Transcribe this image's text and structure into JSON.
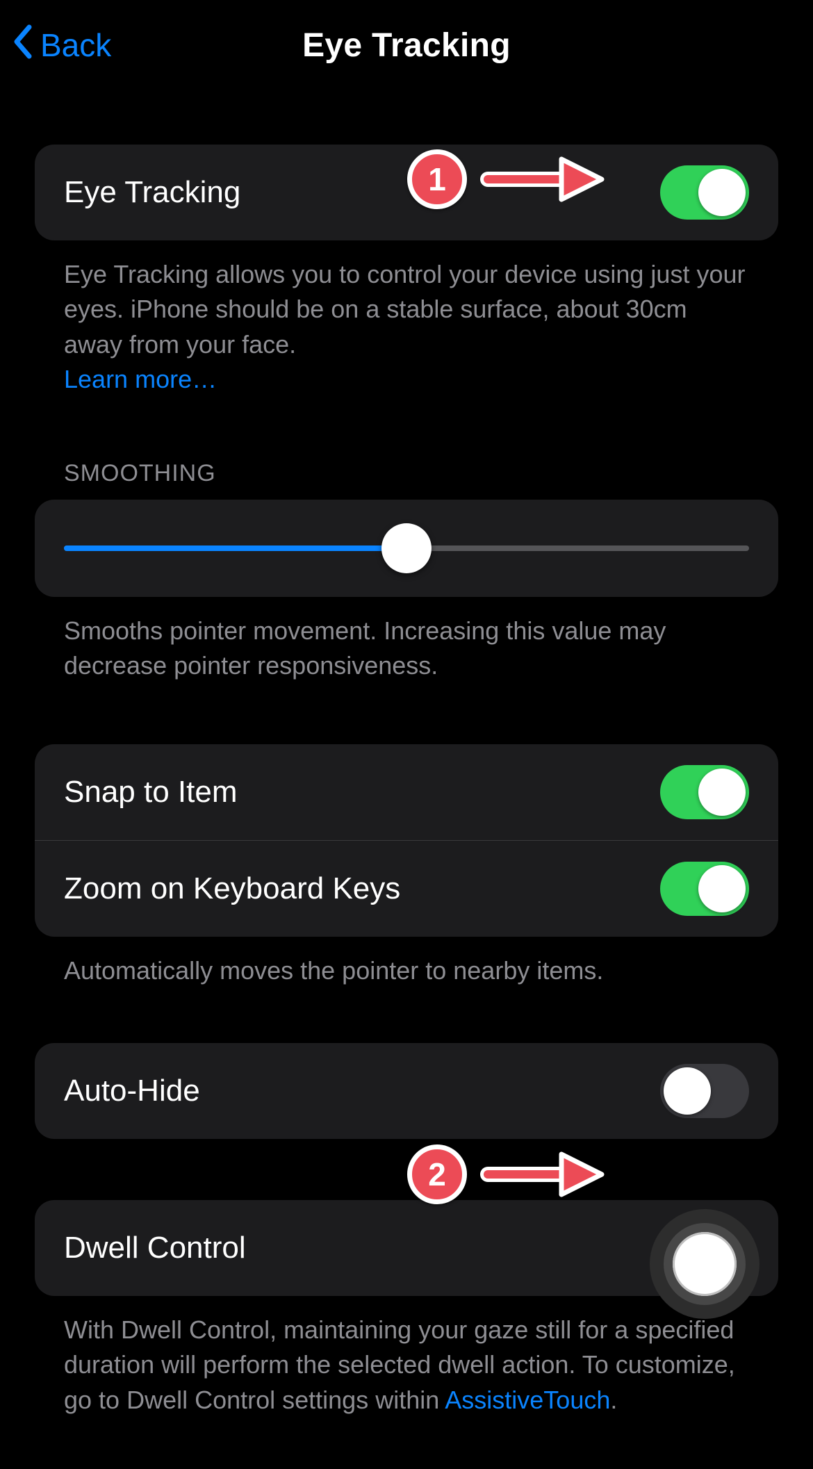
{
  "nav": {
    "back_label": "Back",
    "title": "Eye Tracking"
  },
  "sections": {
    "eye_tracking": {
      "label": "Eye Tracking",
      "on": true,
      "footer": "Eye Tracking allows you to control your device using just your eyes. iPhone should be on a stable surface, about 30cm away from your face.",
      "learn_more": "Learn more…"
    },
    "smoothing": {
      "header": "SMOOTHING",
      "value_percent": 50,
      "footer": "Smooths pointer movement. Increasing this value may decrease pointer responsiveness."
    },
    "snap": {
      "snap_label": "Snap to Item",
      "snap_on": true,
      "zoom_label": "Zoom on Keyboard Keys",
      "zoom_on": true,
      "footer": "Automatically moves the pointer to nearby items."
    },
    "auto_hide": {
      "label": "Auto-Hide",
      "on": false
    },
    "dwell": {
      "label": "Dwell Control",
      "on": true,
      "footer_before": "With Dwell Control, maintaining your gaze still for a specified duration will perform the selected dwell action. To customize, go to Dwell Control settings within ",
      "footer_link": "AssistiveTouch",
      "footer_after": "."
    }
  },
  "annotations": {
    "badge1": "1",
    "badge2": "2"
  },
  "colors": {
    "accent_blue": "#0a84ff",
    "toggle_green": "#30d158",
    "badge_red": "#ec4b56"
  }
}
